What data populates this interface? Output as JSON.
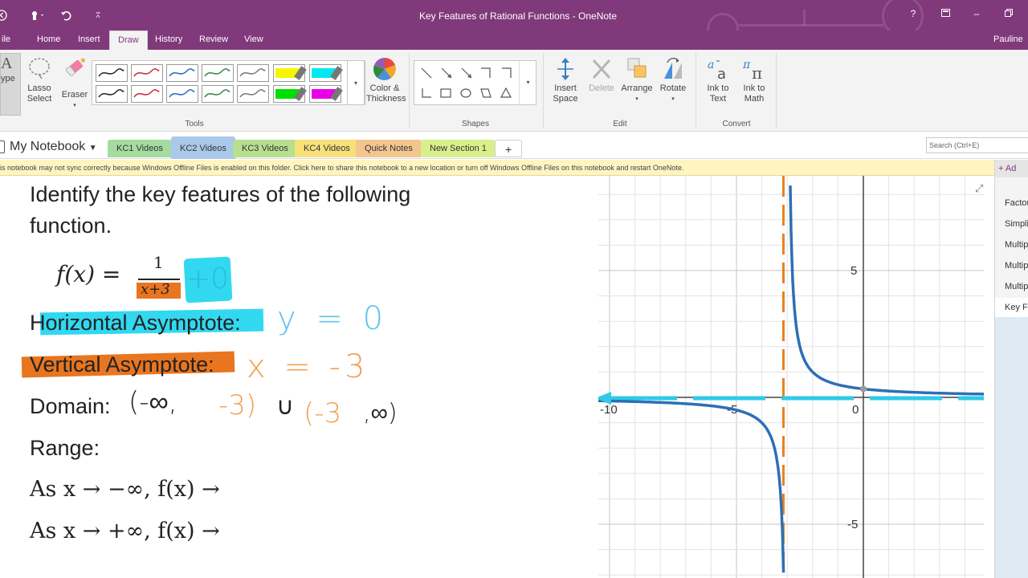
{
  "window": {
    "title": "Key Features of Rational Functions - OneNote",
    "file_tab": "ile",
    "help": "?",
    "user": "Pauline G"
  },
  "tabs": [
    "Home",
    "Insert",
    "Draw",
    "History",
    "Review",
    "View"
  ],
  "ribbon": {
    "type_label": "ype",
    "lasso_select": [
      "Lasso",
      "Select"
    ],
    "eraser": "Eraser",
    "color_thickness": [
      "Color &",
      "Thickness"
    ],
    "insert_space": [
      "Insert",
      "Space"
    ],
    "delete": "Delete",
    "arrange": "Arrange",
    "rotate": "Rotate",
    "ink_to_text": [
      "Ink to",
      "Text"
    ],
    "ink_to_math": [
      "Ink to",
      "Math"
    ],
    "groups": [
      "Tools",
      "Shapes",
      "Edit",
      "Convert"
    ],
    "pen_colors": [
      "#222222",
      "#c8283c",
      "#2a6ab8",
      "#2f8a3e",
      "#777777",
      "#f7f500",
      "#00e8f0",
      "#222222",
      "#c8283c",
      "#2a6ab8",
      "#2f8a3e",
      "#777777",
      "#00e000",
      "#e800e8"
    ]
  },
  "notebook": {
    "name": "My Notebook",
    "sections": [
      {
        "label": "KC1 Videos",
        "color": "#a6dba0"
      },
      {
        "label": "KC2 Videos",
        "color": "#a9c8ea"
      },
      {
        "label": "KC3 Videos",
        "color": "#b7df8f"
      },
      {
        "label": "KC4 Videos",
        "color": "#f6e07a"
      },
      {
        "label": "Quick Notes",
        "color": "#f3c58f"
      },
      {
        "label": "New Section 1",
        "color": "#d9ef8c"
      }
    ],
    "add_section": "+",
    "search_placeholder": "Search (Ctrl+E)"
  },
  "info_bar": "is notebook may not sync correctly because Windows Offline Files is enabled on this folder. Click here to share this notebook to a new location or turn off Windows Offline Files on this notebook and restart OneNote.",
  "pages_pane": {
    "add_page": "+ Ad",
    "pages": [
      "Factor",
      "Simpli",
      "Multip",
      "Multip",
      "Multip",
      "Key Fe"
    ]
  },
  "note": {
    "heading_line1": "Identify the key features of the following",
    "heading_line2": "function.",
    "function": {
      "lhs": "f(x) =",
      "numerator": "1",
      "denominator": "x+3",
      "ink_term": "+0"
    },
    "horizontal_label": "Horizontal Asymptote:",
    "horizontal_answer": "y = 0",
    "vertical_label": "Vertical Asymptote:",
    "vertical_answer": "x = -3",
    "domain_label": "Domain:",
    "domain_answer": [
      "(-∞,",
      "-3)",
      "∪",
      "(-3",
      ",∞)"
    ],
    "range_label": "Range:",
    "limit_neg": "As x → −∞, f(x) →",
    "limit_pos": "As x → +∞, f(x) →"
  },
  "graph": {
    "x_ticks": [
      "-10",
      "-5",
      "0"
    ],
    "y_ticks": [
      "5",
      "-5"
    ],
    "curve_color": "#2d6fb5",
    "vertical_asymptote_color": "#e8821e",
    "horizontal_asymptote_color": "#31c9e8"
  }
}
